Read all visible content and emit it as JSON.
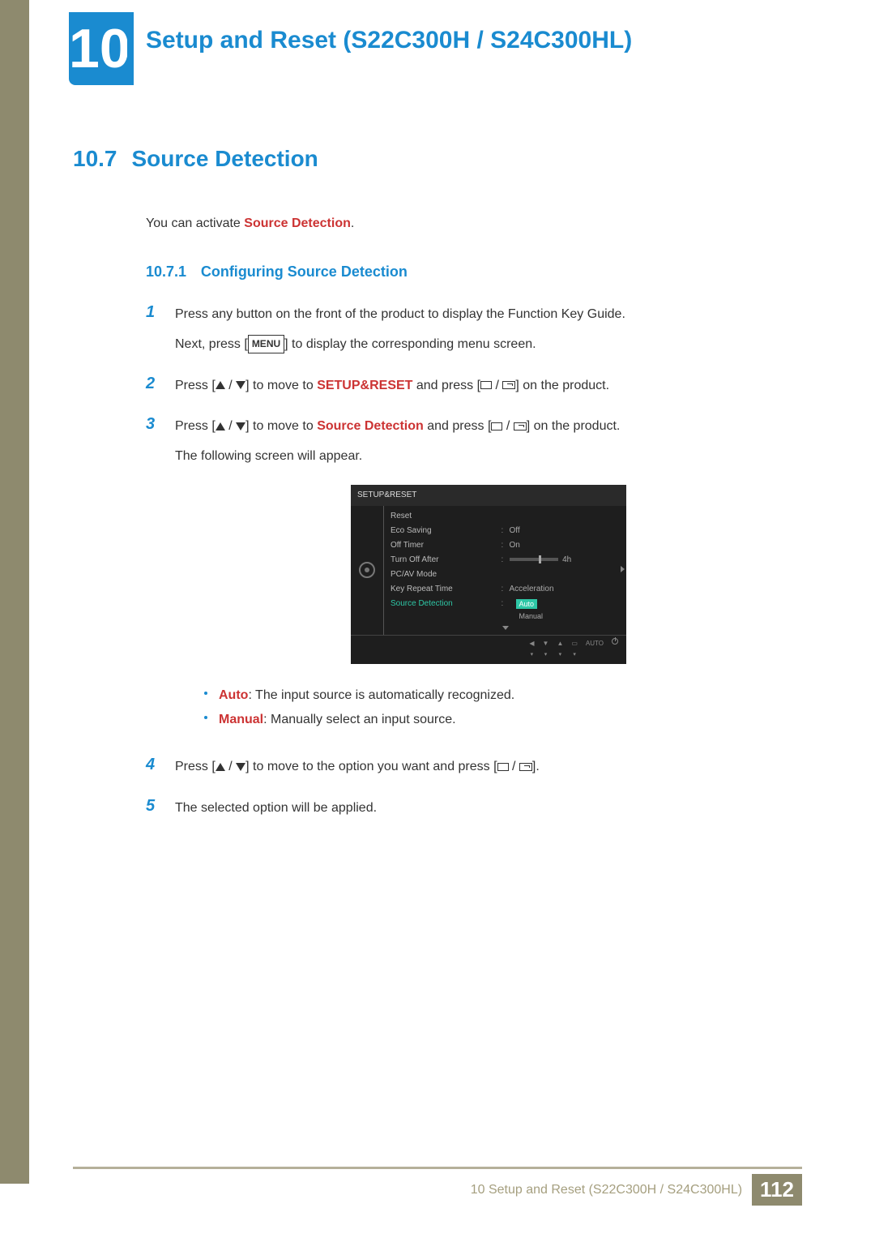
{
  "chapter": {
    "number": "10",
    "title": "Setup and Reset (S22C300H / S24C300HL)"
  },
  "section": {
    "number": "10.7",
    "title": "Source Detection"
  },
  "intro": {
    "prefix": "You can activate ",
    "term": "Source Detection",
    "suffix": "."
  },
  "subsection": {
    "number": "10.7.1",
    "title": "Configuring Source Detection"
  },
  "steps": {
    "s1": {
      "line1": "Press any button on the front of the product to display the Function Key Guide.",
      "line2a": "Next, press [",
      "menu": "MENU",
      "line2b": "] to display the corresponding menu screen."
    },
    "s2": {
      "a": "Press [",
      "b": "] to move to ",
      "term": "SETUP&RESET",
      "c": " and press [",
      "d": "] on the product."
    },
    "s3": {
      "a": "Press [",
      "b": "] to move to ",
      "term": "Source Detection",
      "c": " and press [",
      "d": "] on the product.",
      "line2": "The following screen will appear."
    },
    "s4": {
      "a": "Press [",
      "b": "] to move to the option you want and press [",
      "c": "]."
    },
    "s5": "The selected option will be applied."
  },
  "osd": {
    "header": "SETUP&RESET",
    "rows": [
      {
        "name": "Reset",
        "val": ""
      },
      {
        "name": "Eco Saving",
        "val": "Off"
      },
      {
        "name": "Off Timer",
        "val": "On"
      },
      {
        "name": "Turn Off After",
        "val": "4h",
        "slider": true
      },
      {
        "name": "PC/AV Mode",
        "val": ""
      },
      {
        "name": "Key Repeat Time",
        "val": "Acceleration"
      }
    ],
    "selected": {
      "name": "Source Detection",
      "options": [
        "Auto",
        "Manual"
      ],
      "highlight": "Auto"
    },
    "footer_auto": "AUTO"
  },
  "bullets": {
    "auto": {
      "term": "Auto",
      "desc": ": The input source is automatically recognized."
    },
    "manual": {
      "term": "Manual",
      "desc": ": Manually select an input source."
    }
  },
  "footer": {
    "text": "10 Setup and Reset (S22C300H / S24C300HL)",
    "page": "112"
  }
}
